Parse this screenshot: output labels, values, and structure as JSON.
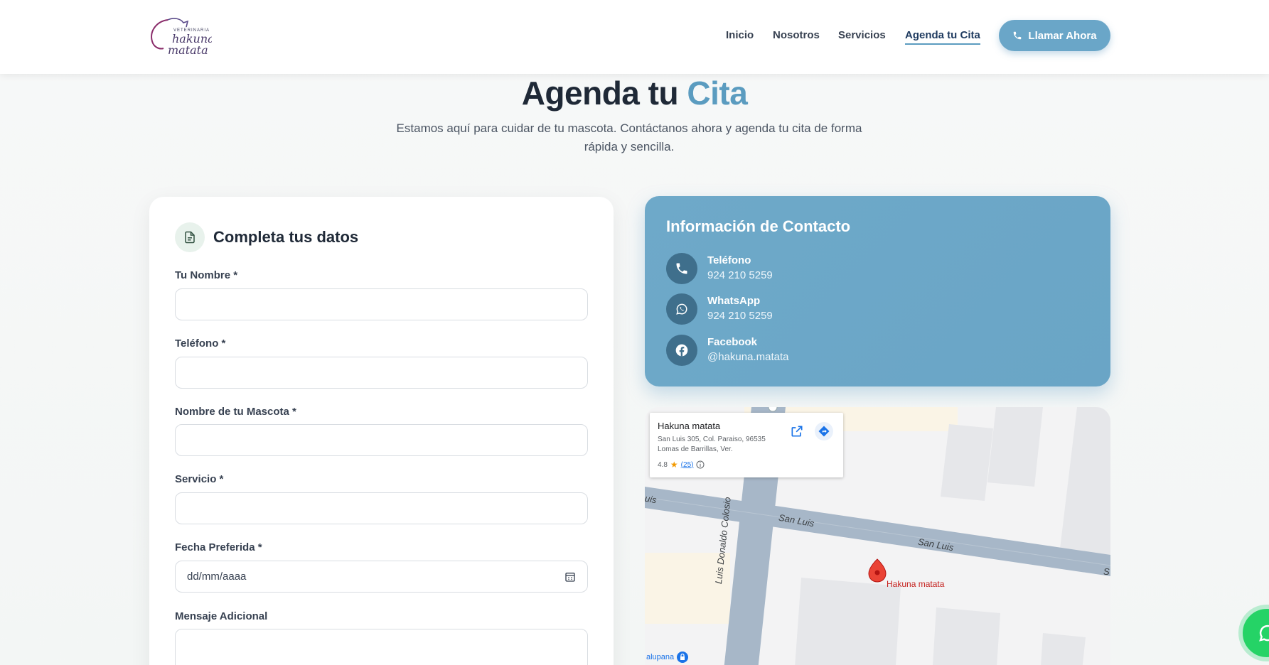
{
  "header": {
    "logo_alt": "Veterinaria Hakuna Matata",
    "nav": [
      {
        "label": "Inicio"
      },
      {
        "label": "Nosotros"
      },
      {
        "label": "Servicios"
      },
      {
        "label": "Agenda tu Cita",
        "active": true
      }
    ],
    "cta_label": "Llamar Ahora"
  },
  "hero": {
    "title_main": "Agenda tu",
    "title_accent": "Cita",
    "subtitle": "Estamos aquí para cuidar de tu mascota. Contáctanos ahora y agenda tu cita de forma rápida y sencilla."
  },
  "form": {
    "title": "Completa tus datos",
    "fields": [
      {
        "label": "Tu Nombre *",
        "value": ""
      },
      {
        "label": "Teléfono *",
        "value": ""
      },
      {
        "label": "Nombre de tu Mascota *",
        "value": ""
      },
      {
        "label": "Servicio *",
        "value": ""
      },
      {
        "label": "Fecha Preferida *",
        "value": "dd/mm/aaaa"
      },
      {
        "label": "Mensaje Adicional",
        "value": ""
      }
    ]
  },
  "contact": {
    "title": "Información de Contacto",
    "items": [
      {
        "label": "Teléfono",
        "value": "924 210 5259",
        "icon": "phone-icon"
      },
      {
        "label": "WhatsApp",
        "value": "924 210 5259",
        "icon": "whatsapp-icon"
      },
      {
        "label": "Facebook",
        "value": "@hakuna.matata",
        "icon": "facebook-icon"
      }
    ]
  },
  "map": {
    "place_name": "Hakuna matata",
    "address": "San Luis 305, Col. Paraiso, 96535 Lomas de Barrillas, Ver.",
    "rating": "4.8",
    "reviews": "(25)",
    "pin_label": "Hakuna matata",
    "streets": [
      "San Luis",
      "San Luis",
      "Luis Donaldo Colosio",
      "uis",
      "S"
    ],
    "poi": "alupana"
  },
  "colors": {
    "accent": "#5b9cc0",
    "contact_bg": "#6aa5c6",
    "whatsapp": "#25d366"
  }
}
